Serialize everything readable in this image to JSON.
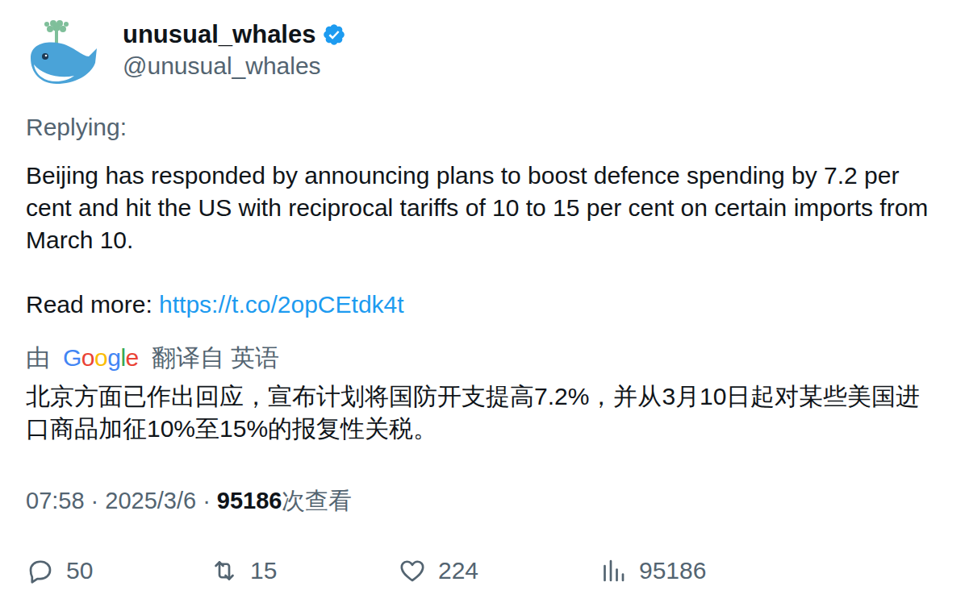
{
  "author": {
    "name": "unusual_whales",
    "handle": "@unusual_whales",
    "verified": true
  },
  "replying": "Replying:",
  "body": "Beijing has responded by announcing plans to boost defence spending by 7.2 per cent and hit the US with reciprocal tariffs of 10 to 15 per cent on certain imports from March 10.",
  "read_more": {
    "label": "Read more: ",
    "link": "https://t.co/2opCEtdk4t"
  },
  "translation": {
    "prefix": "由",
    "brand": "Google",
    "suffix": "翻译自 英语",
    "text": "北京方面已作出回应，宣布计划将国防开支提高7.2%，并从3月10日起对某些美国进口商品加征10%至15%的报复性关税。"
  },
  "meta": {
    "time": "07:58",
    "separator": "·",
    "date": "2025/3/6",
    "views": "95186",
    "views_label": "次查看"
  },
  "actions": [
    {
      "kind": "reply",
      "count": "50"
    },
    {
      "kind": "retweet",
      "count": "15"
    },
    {
      "kind": "like",
      "count": "224"
    },
    {
      "kind": "views",
      "count": "95186"
    }
  ]
}
